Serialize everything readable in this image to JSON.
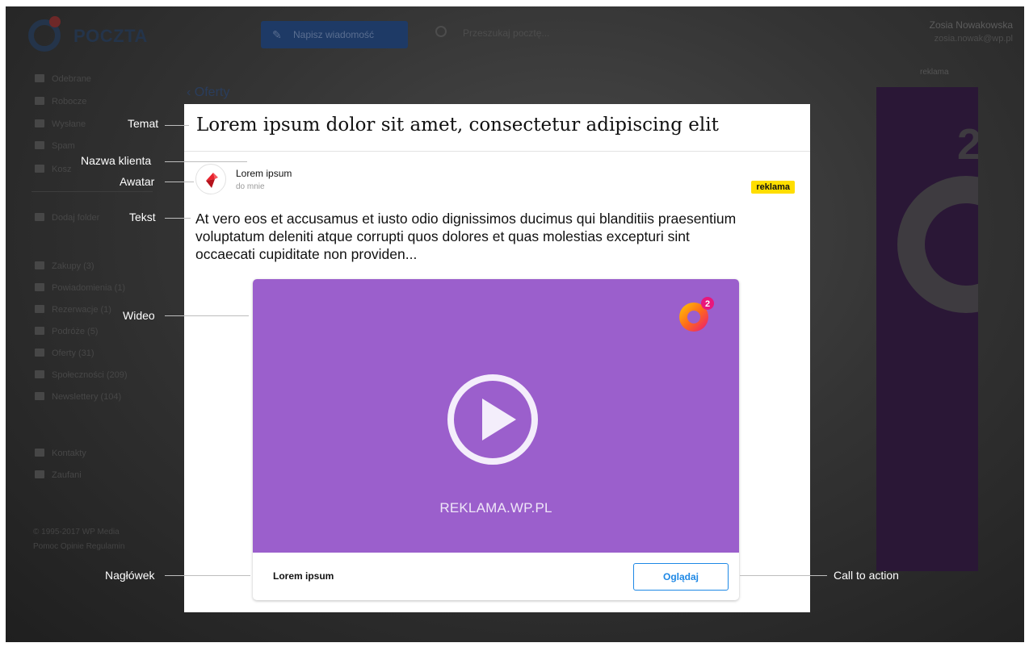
{
  "app": {
    "logo_icon": "at-sign-logo-icon",
    "name": "POCZTA",
    "compose_label": "Napisz wiadomość",
    "compose_icon": "pencil-icon",
    "search_placeholder": "Przeszukaj pocztę...",
    "user_name": "Zosia Nowakowska",
    "user_email": "zosia.nowak@wp.pl",
    "ad_label": "reklama",
    "back_label": "Oferty",
    "sidebar": [
      {
        "label": "Odebrane",
        "icon": "inbox-icon"
      },
      {
        "label": "Robocze",
        "icon": "draft-icon"
      },
      {
        "label": "Wysłane",
        "icon": "send-icon"
      },
      {
        "label": "Spam",
        "icon": "spam-icon"
      },
      {
        "label": "Kosz",
        "icon": "trash-icon"
      },
      {
        "label": "Dodaj folder",
        "icon": "plus-icon"
      },
      {
        "label": "Zakupy (3)",
        "icon": "bag-icon"
      },
      {
        "label": "Powiadomienia (1)",
        "icon": "bell-icon"
      },
      {
        "label": "Rezerwacje (1)",
        "icon": "edit-icon"
      },
      {
        "label": "Podróże (5)",
        "icon": "suitcase-icon"
      },
      {
        "label": "Oferty (31)",
        "icon": "tag-icon"
      },
      {
        "label": "Społeczności (209)",
        "icon": "people-icon"
      },
      {
        "label": "Newslettery (104)",
        "icon": "newsletter-icon"
      },
      {
        "label": "Kontakty",
        "icon": "contacts-icon"
      },
      {
        "label": "Zaufani",
        "icon": "trusted-icon"
      }
    ],
    "footer_line1": "© 1995-2017 WP Media",
    "footer_line2": "Pomoc Opinie Regulamin"
  },
  "message": {
    "subject": "Lorem ipsum dolor sit amet, consectetur adipiscing elit",
    "client_name": "Lorem ipsum",
    "recipient": "do mnie",
    "badge": "reklama",
    "body": "At vero eos et accusamus et iusto odio dignissimos ducimus qui blanditiis praesentium voluptatum deleniti atque corrupti quos dolores et quas molestias excepturi sint occaecati cupiditate non providen...",
    "video_caption": "REKLAMA.WP.PL",
    "headline": "Lorem ipsum",
    "cta_label": "Oglądaj",
    "avatar_icon": "brand-avatar-icon",
    "play_icon": "play-icon",
    "video_logo_icon": "at-two-logo-icon"
  },
  "annotations": {
    "subject": "Temat",
    "client_name": "Nazwa klienta",
    "avatar": "Awatar",
    "text": "Tekst",
    "video": "Wideo",
    "headline": "Nagłówek",
    "cta": "Call to action"
  },
  "colors": {
    "video_bg": "#9b5fcc",
    "badge_bg": "#ffde00",
    "cta_blue": "#1e88e5",
    "backdrop": "#2d2d2d"
  }
}
